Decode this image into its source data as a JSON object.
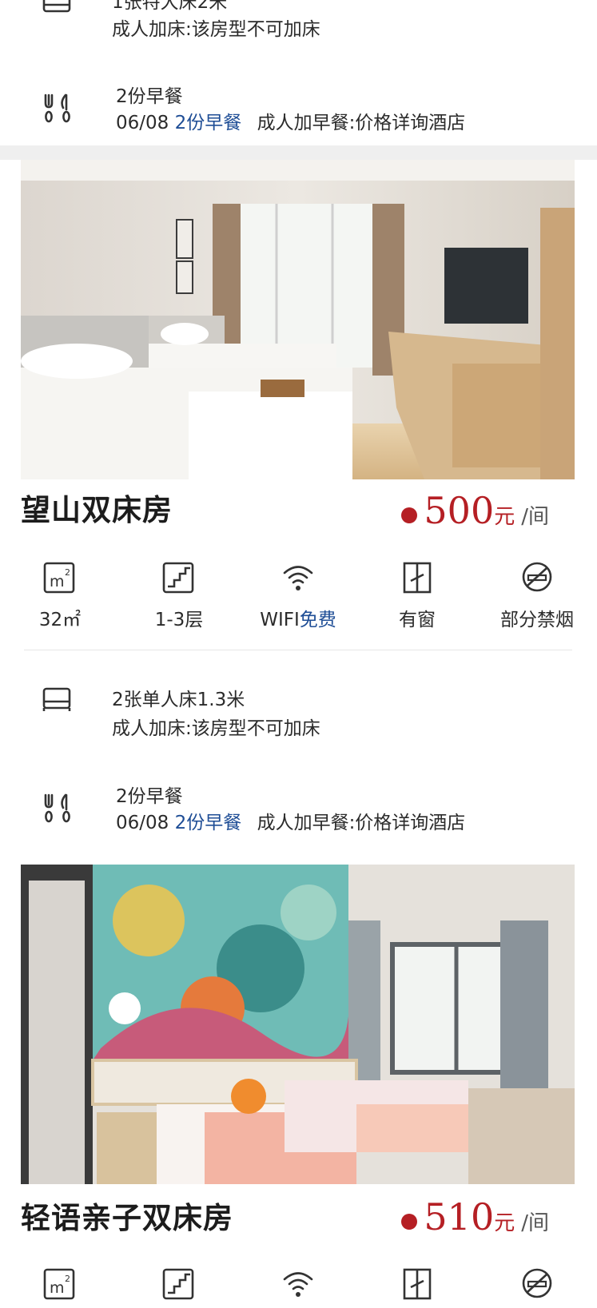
{
  "top_block": {
    "bed_line1": "1张特大床2米",
    "bed_line2": "成人加床:该房型不可加床",
    "breakfast_line1": "2份早餐",
    "breakfast_date": "06/08",
    "breakfast_highlight": "2份早餐",
    "breakfast_extra": "成人加早餐:价格详询酒店"
  },
  "rooms": [
    {
      "name": "望山双床房",
      "price": "500",
      "currency": "元",
      "per": "/间",
      "features": {
        "area": "32㎡",
        "floor": "1-3层",
        "wifi_prefix": "WIFI",
        "wifi_value": "免费",
        "window": "有窗",
        "smoking": "部分禁烟"
      },
      "bed_line1": "2张单人床1.3米",
      "bed_line2": "成人加床:该房型不可加床",
      "breakfast_line1": "2份早餐",
      "breakfast_date": "06/08",
      "breakfast_highlight": "2份早餐",
      "breakfast_extra": "成人加早餐:价格详询酒店"
    },
    {
      "name": "轻语亲子双床房",
      "price": "510",
      "currency": "元",
      "per": "/间"
    }
  ],
  "icons": {
    "bed": "bed-icon",
    "breakfast": "fork-knife-icon",
    "area": "square-meter-icon",
    "floor": "stairs-icon",
    "wifi": "wifi-icon",
    "window": "window-icon",
    "smoking": "no-smoking-icon"
  },
  "colors": {
    "price_red": "#b51f24",
    "link_blue": "#1f4e96",
    "separator_gray": "#efefef"
  }
}
